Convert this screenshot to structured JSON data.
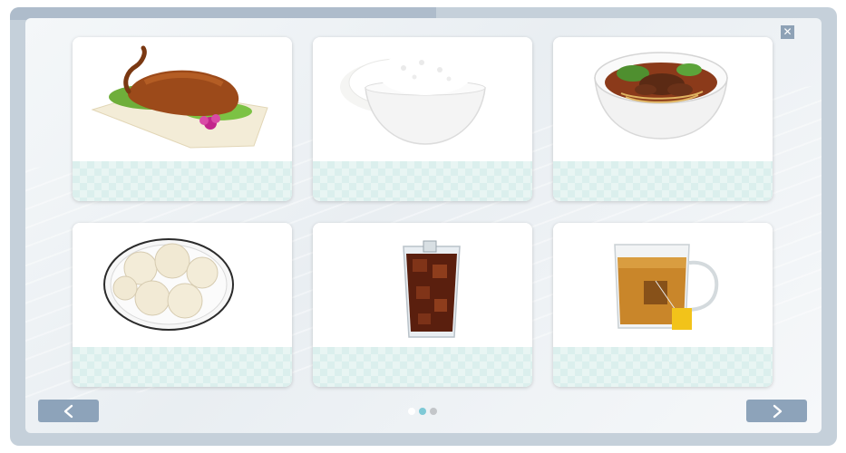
{
  "dialog": {
    "close_glyph": "✕"
  },
  "cards": [
    {
      "item": "roast-duck",
      "label": ""
    },
    {
      "item": "rice-bowl",
      "label": ""
    },
    {
      "item": "beef-noodle-soup",
      "label": ""
    },
    {
      "item": "steamed-buns",
      "label": ""
    },
    {
      "item": "cola-glass",
      "label": ""
    },
    {
      "item": "tea-mug",
      "label": ""
    }
  ],
  "navigation": {
    "prev_icon": "chevron-left-icon",
    "next_icon": "chevron-right-icon",
    "pages": 3,
    "current_page": 2
  },
  "colors": {
    "frame": "#c5d0da",
    "nav_button": "#8da3ba",
    "card_label_bg": "#dbefed",
    "active_dot": "#7ec9d6"
  }
}
